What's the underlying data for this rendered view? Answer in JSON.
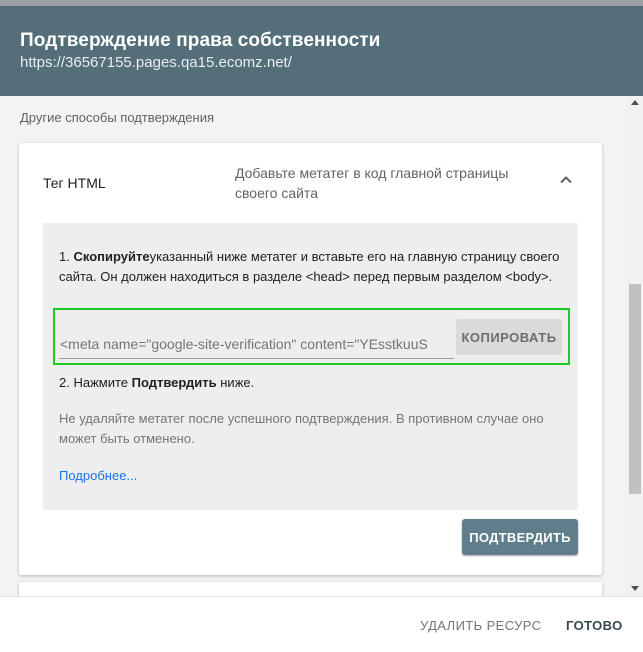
{
  "header": {
    "title": "Подтверждение права собственности",
    "url": "https://36567155.pages.qa15.ecomz.net/"
  },
  "section": {
    "label": "Другие способы подтверждения"
  },
  "method": {
    "title": "Тег HTML",
    "description": "Добавьте метатег в код главной страницы своего сайта",
    "toggle_icon": "chevron-up-icon"
  },
  "instructions": {
    "step1_bold": "Скопируйте",
    "step1_rest": "указанный ниже метатег и вставьте его на главную страницу своего сайта. Он должен находиться в разделе <head> перед первым разделом <body>.",
    "meta_tag": "<meta name=\"google-site-verification\" content=\"YEsstkuuS",
    "copy_label": "КОПИРОВАТЬ",
    "step2_prefix": "2. Нажмите ",
    "step2_bold": "Подтвердить",
    "step2_suffix": " ниже.",
    "warning": "Не удаляйте метатег после успешного подтверждения. В противном случае оно может быть отменено.",
    "more_link": "Подробнее..."
  },
  "actions": {
    "confirm_label": "ПОДТВЕРДИТЬ"
  },
  "footer": {
    "delete_label": "УДАЛИТЬ РЕСУРС",
    "done_label": "ГОТОВО"
  },
  "colors": {
    "header_bg": "#546e7a",
    "confirm_bg": "#607d8b",
    "highlight": "#22c922",
    "link": "#1a73e8"
  }
}
